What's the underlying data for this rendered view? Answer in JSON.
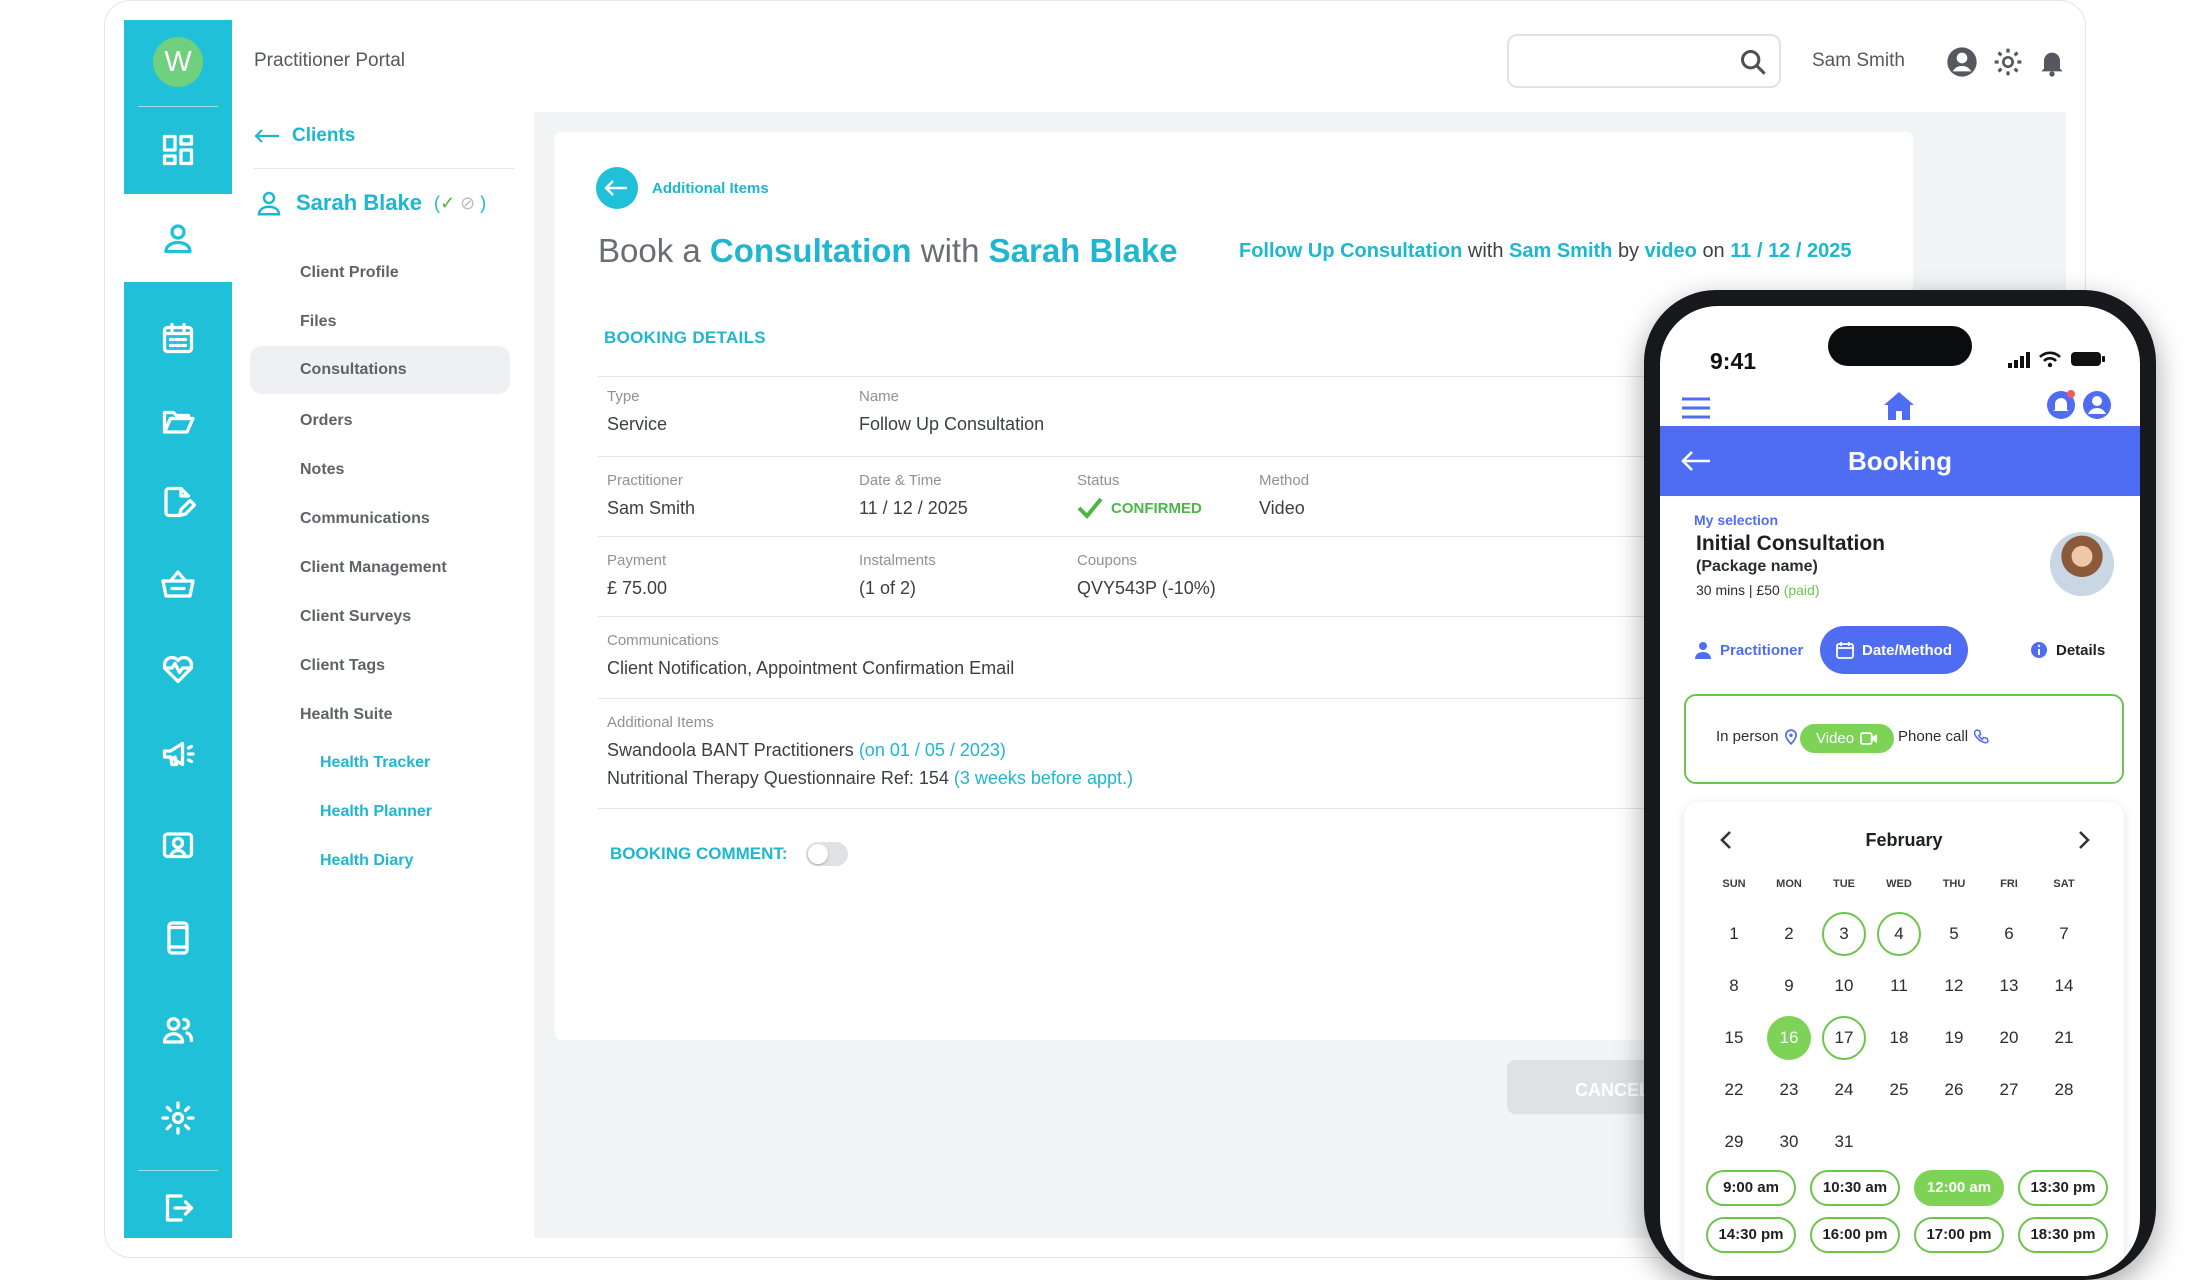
{
  "app": {
    "logo_letter": "W",
    "portal_title": "Practitioner Portal"
  },
  "header": {
    "search_placeholder": "",
    "user_name": "Sam Smith"
  },
  "sidebar": {
    "back_label": "Clients",
    "client": {
      "name": "Sarah Blake",
      "meta_open": "(",
      "meta_check": "✓",
      "meta_close": ")"
    },
    "items": [
      {
        "label": "Client Profile"
      },
      {
        "label": "Files"
      },
      {
        "label": "Consultations"
      },
      {
        "label": "Orders"
      },
      {
        "label": "Notes"
      },
      {
        "label": "Communications"
      },
      {
        "label": "Client Management"
      },
      {
        "label": "Client Surveys"
      },
      {
        "label": "Client Tags"
      },
      {
        "label": "Health Suite"
      }
    ],
    "subitems": [
      {
        "label": "Health Tracker"
      },
      {
        "label": "Health Planner"
      },
      {
        "label": "Health Diary"
      }
    ]
  },
  "booking": {
    "back_link": "Additional Items",
    "heading": {
      "p1": "Book a",
      "p2": "Consultation",
      "p3": "with",
      "p4": "Sarah Blake"
    },
    "summary": {
      "s1": "Follow Up Consultation",
      "s2": "with",
      "s3": "Sam Smith",
      "s4": "by",
      "s5": "video",
      "s6": "on",
      "s7": "11 / 12 / 2025"
    },
    "section_title": "BOOKING DETAILS",
    "type_label": "Type",
    "type_value": "Service",
    "name_label": "Name",
    "name_value": "Follow Up Consultation",
    "practitioner_label": "Practitioner",
    "practitioner_value": "Sam Smith",
    "datetime_label": "Date & Time",
    "datetime_value": "11 / 12 / 2025",
    "status_label": "Status",
    "status_value": "CONFIRMED",
    "method_label": "Method",
    "method_value": "Video",
    "payment_label": "Payment",
    "payment_value": "£ 75.00",
    "instalments_label": "Instalments",
    "instalments_value": "(1 of 2)",
    "coupons_label": "Coupons",
    "coupons_value": "QVY543P (-10%)",
    "communications_label": "Communications",
    "communications_value": "Client Notification, Appointment Confirmation Email",
    "additional_label": "Additional Items",
    "additional_1": "Swandoola BANT Practitioners",
    "additional_1_note": "(on 01 / 05 / 2023)",
    "additional_2": "Nutritional Therapy Questionnaire Ref: 154",
    "additional_2_note": "(3 weeks before appt.)",
    "comment_label": "BOOKING COMMENT:",
    "cancel_label": "CANCEL"
  },
  "phone": {
    "time": "9:41",
    "title": "Booking",
    "my_selection": "My selection",
    "product_name": "Initial Consultation",
    "package_name": "(Package name)",
    "duration_price": "30 mins  |  £50",
    "paid": "(paid)",
    "tabs": [
      "Practitioner",
      "Date/Method",
      "Details"
    ],
    "methods": [
      "In person",
      "Video",
      "Phone call"
    ],
    "month": "February",
    "weekdays": [
      "SUN",
      "MON",
      "TUE",
      "WED",
      "THU",
      "FRI",
      "SAT"
    ],
    "days": [
      "1",
      "2",
      "3",
      "4",
      "5",
      "6",
      "7",
      "8",
      "9",
      "10",
      "11",
      "12",
      "13",
      "14",
      "15",
      "16",
      "17",
      "18",
      "19",
      "20",
      "21",
      "22",
      "23",
      "24",
      "25",
      "26",
      "27",
      "28",
      "29",
      "30",
      "31"
    ],
    "slots": [
      "9:00 am",
      "10:30 am",
      "12:00 am",
      "13:30 pm",
      "14:30 pm",
      "16:00 pm",
      "17:00 pm",
      "18:30 pm"
    ]
  },
  "colors": {
    "accent": "#1fc0d8",
    "green": "#6cc44a",
    "phone_blue": "#4f6df2"
  }
}
